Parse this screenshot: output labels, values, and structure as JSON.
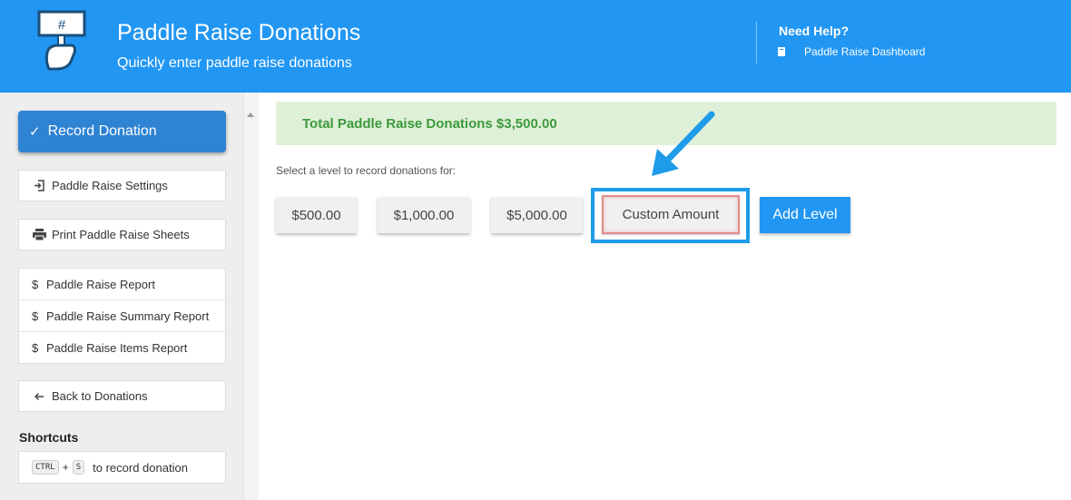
{
  "header": {
    "title": "Paddle Raise Donations",
    "subtitle": "Quickly enter paddle raise donations",
    "logo_text": "#",
    "help_title": "Need Help?",
    "help_link": "Paddle Raise Dashboard"
  },
  "sidebar": {
    "primary_button": "Record Donation",
    "settings": "Paddle Raise Settings",
    "print_sheets": "Print Paddle Raise Sheets",
    "reports": [
      {
        "icon": "$",
        "label": "Paddle Raise Report"
      },
      {
        "icon": "$",
        "label": "Paddle Raise Summary Report"
      },
      {
        "icon": "$",
        "label": "Paddle Raise Items Report"
      }
    ],
    "back": "Back to Donations",
    "shortcuts_title": "Shortcuts",
    "shortcut": {
      "key1": "CTRL",
      "plus": "+",
      "key2": "S",
      "text": "to record donation"
    }
  },
  "main": {
    "total_banner": "Total Paddle Raise Donations $3,500.00",
    "prompt": "Select a level to record donations for:",
    "levels": [
      "$500.00",
      "$1,000.00",
      "$5,000.00"
    ],
    "custom_amount": "Custom Amount",
    "add_level": "Add Level"
  },
  "colors": {
    "header_bg": "#2196f3",
    "primary_button": "#2e83d3",
    "banner_bg": "#dff0d8",
    "banner_text": "#3c9a3c",
    "highlight": "#1e9be9",
    "custom_border": "#e08b8b"
  },
  "icons": {
    "check": "check-icon",
    "settings": "sign-in-icon",
    "print": "print-icon",
    "back": "arrow-left-icon",
    "help": "book-icon",
    "annotation": "annotation-arrow-icon"
  }
}
